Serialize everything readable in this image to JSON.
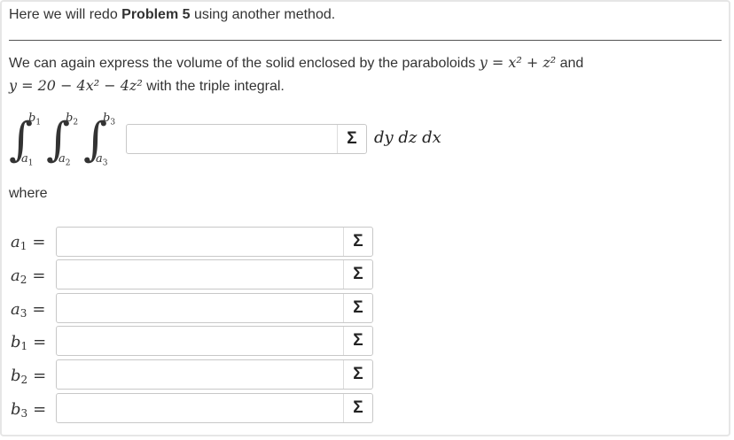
{
  "intro": {
    "prefix": "Here we will redo ",
    "bold": "Problem 5",
    "suffix": " using another method."
  },
  "description": {
    "text1": "We can again express the volume of the solid enclosed by the paraboloids ",
    "eq1": "y = x² + z²",
    "and": " and",
    "eq2": "y = 20 − 4x² − 4z²",
    "text2": " with the triple integral."
  },
  "integral": {
    "upper_bounds": [
      "b",
      "b",
      "b"
    ],
    "lower_bounds": [
      "a",
      "a",
      "a"
    ],
    "indices": [
      "1",
      "2",
      "3"
    ],
    "integrand_value": "",
    "differentials": "dy dz dx"
  },
  "where_label": "where",
  "bounds": [
    {
      "var": "a",
      "sub": "1",
      "eq": "=",
      "value": ""
    },
    {
      "var": "a",
      "sub": "2",
      "eq": "=",
      "value": ""
    },
    {
      "var": "a",
      "sub": "3",
      "eq": "=",
      "value": ""
    },
    {
      "var": "b",
      "sub": "1",
      "eq": "=",
      "value": ""
    },
    {
      "var": "b",
      "sub": "2",
      "eq": "=",
      "value": ""
    },
    {
      "var": "b",
      "sub": "3",
      "eq": "=",
      "value": ""
    }
  ],
  "sigma_icon": "Σ"
}
